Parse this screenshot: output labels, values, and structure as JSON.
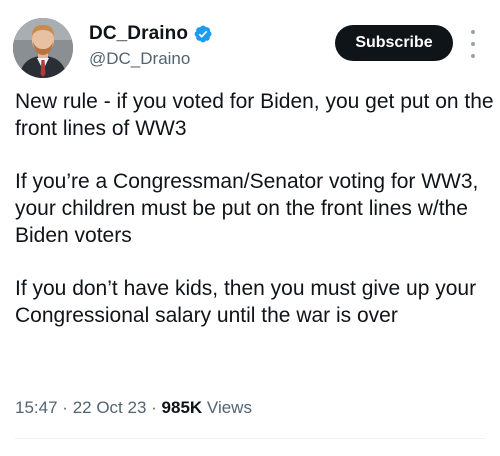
{
  "author": {
    "display_name": "DC_Draino",
    "handle": "@DC_Draino",
    "verified": true,
    "verified_color": "#1d9bf0"
  },
  "actions": {
    "subscribe_label": "Subscribe",
    "more_icon": "more-dots-vertical"
  },
  "tweet": {
    "paragraphs": [
      "New rule - if you voted for Biden, you get put on the front lines of WW3",
      "If you’re a Congressman/Senator voting for WW3, your children must be put on the front lines w/the Biden voters",
      "If you don’t have kids, then you must give up your Congressional salary until the war is over"
    ],
    "time": "15:47",
    "date": "22 Oct 23",
    "separator": "·",
    "views_count": "985K",
    "views_label": "Views"
  }
}
